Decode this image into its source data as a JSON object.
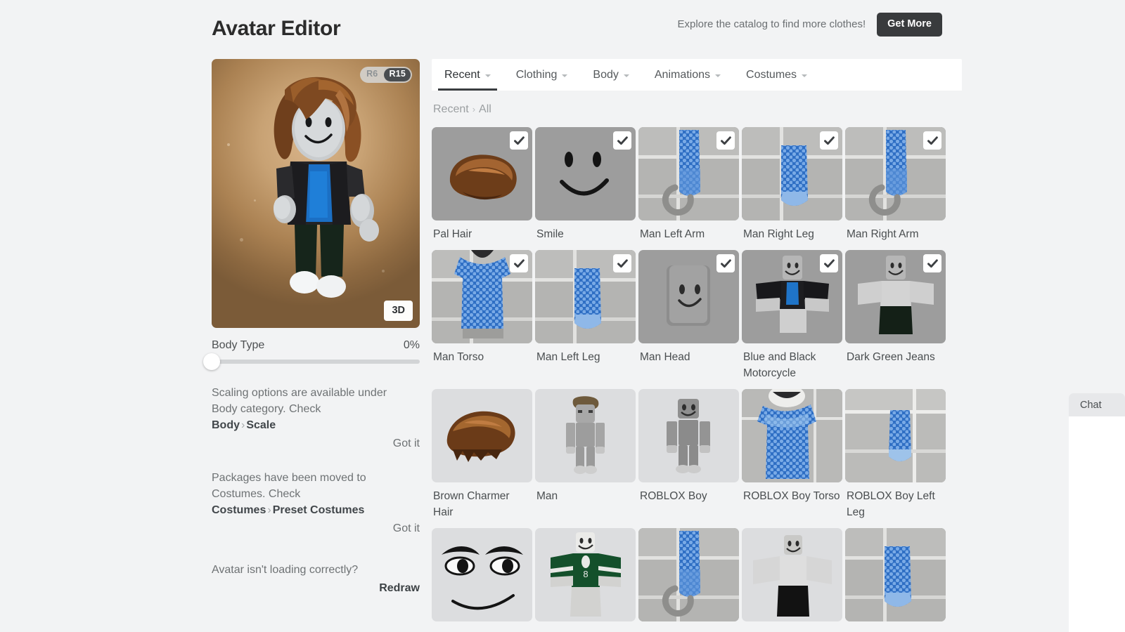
{
  "header": {
    "title": "Avatar Editor",
    "note": "Explore the catalog to find more clothes!",
    "get_more_label": "Get More"
  },
  "avatar_preview": {
    "rig_options": [
      "R6",
      "R15"
    ],
    "rig_selected": "R15",
    "view_button_label": "3D"
  },
  "body_type": {
    "label": "Body Type",
    "value_label": "0%",
    "value": 0
  },
  "notices": [
    {
      "text_lead": "Scaling options are available under Body category. Check ",
      "path_a": "Body",
      "path_sep": "›",
      "path_b": "Scale",
      "action": "Got it"
    },
    {
      "text_lead": "Packages have been moved to Costumes. Check ",
      "path_a": "Costumes",
      "path_sep": "›",
      "path_b": "Preset Costumes",
      "action": "Got it"
    }
  ],
  "redraw": {
    "question": "Avatar isn't loading correctly?",
    "action": "Redraw"
  },
  "tabs": [
    {
      "label": "Recent",
      "active": true
    },
    {
      "label": "Clothing",
      "active": false
    },
    {
      "label": "Body",
      "active": false
    },
    {
      "label": "Animations",
      "active": false
    },
    {
      "label": "Costumes",
      "active": false
    }
  ],
  "breadcrumb": {
    "root": "Recent",
    "sep": "›",
    "leaf": "All"
  },
  "items": [
    {
      "label": "Pal Hair",
      "checked": true,
      "bg": "dark",
      "art": "hair-pal"
    },
    {
      "label": "Smile",
      "checked": true,
      "bg": "dark",
      "art": "smile"
    },
    {
      "label": "Man Left Arm",
      "checked": true,
      "bg": "dark",
      "art": "arm-left"
    },
    {
      "label": "Man Right Leg",
      "checked": true,
      "bg": "dark",
      "art": "leg-right"
    },
    {
      "label": "Man Right Arm",
      "checked": true,
      "bg": "dark",
      "art": "arm-right"
    },
    {
      "label": "Man Torso",
      "checked": true,
      "bg": "dark",
      "art": "torso"
    },
    {
      "label": "Man Left Leg",
      "checked": true,
      "bg": "dark",
      "art": "leg-left"
    },
    {
      "label": "Man Head",
      "checked": true,
      "bg": "dark",
      "art": "head"
    },
    {
      "label": "Blue and Black Motorcycle",
      "checked": true,
      "bg": "dark",
      "art": "figure-jacket"
    },
    {
      "label": "Dark Green Jeans",
      "checked": true,
      "bg": "dark",
      "art": "figure-jeans"
    },
    {
      "label": "Brown Charmer Hair",
      "checked": false,
      "bg": "light",
      "art": "hair-charmer"
    },
    {
      "label": "Man",
      "checked": false,
      "bg": "light",
      "art": "figure-man"
    },
    {
      "label": "ROBLOX Boy",
      "checked": false,
      "bg": "light",
      "art": "figure-boy"
    },
    {
      "label": "ROBLOX Boy Torso",
      "checked": false,
      "bg": "dark",
      "art": "boy-torso"
    },
    {
      "label": "ROBLOX Boy Left Leg",
      "checked": false,
      "bg": "dark",
      "art": "boy-leftleg"
    },
    {
      "label": "",
      "checked": false,
      "bg": "light",
      "art": "face-eyes"
    },
    {
      "label": "",
      "checked": false,
      "bg": "light",
      "art": "figure-green"
    },
    {
      "label": "",
      "checked": false,
      "bg": "dark",
      "art": "arm-blue2"
    },
    {
      "label": "",
      "checked": false,
      "bg": "light",
      "art": "figure-blackpants"
    },
    {
      "label": "",
      "checked": false,
      "bg": "dark",
      "art": "leg-blue2"
    }
  ],
  "chat": {
    "title": "Chat"
  },
  "colors": {
    "page_bg": "#f2f3f4",
    "accent_dark": "#393b3d",
    "card_bg_dark": "#9d9d9d",
    "card_bg_light": "#dcdddf",
    "tab_underline": "#3a3d40"
  }
}
